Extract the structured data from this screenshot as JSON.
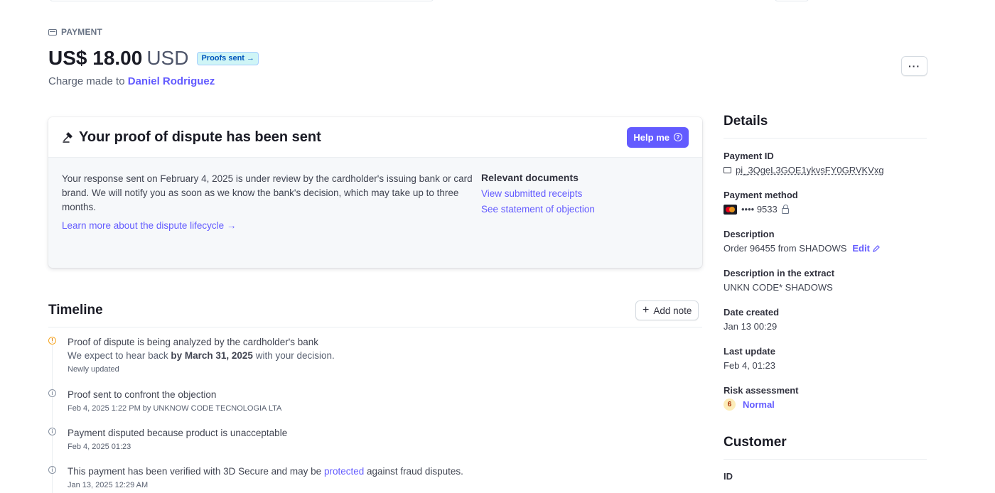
{
  "header": {
    "eyebrow": "PAYMENT",
    "amount": "US$ 18.00",
    "currency": "USD",
    "status_badge": "Proofs sent →",
    "charge_prefix": "Charge made to",
    "customer_name": "Daniel Rodriguez",
    "more_label": "···"
  },
  "dispute_card": {
    "title": "Your proof of dispute has been sent",
    "help_label": "Help me",
    "body": "Your response sent on February 4, 2025 is under review by the cardholder's issuing bank or card brand. We will notify you as soon as we know the bank's decision, which may take up to three months.",
    "learn_more": "Learn more about the dispute lifecycle →",
    "docs_title": "Relevant documents",
    "docs": [
      "View submitted receipts",
      "See statement of objection"
    ]
  },
  "timeline": {
    "title": "Timeline",
    "add_note_label": "Add note",
    "events": [
      {
        "icon": "warning-icon",
        "text": "Proof of dispute is being analyzed by the cardholder's bank",
        "sub_prefix": "We expect to hear back",
        "sub_bold": "by March 31, 2025",
        "sub_suffix": "with your decision.",
        "meta": "Newly updated"
      },
      {
        "icon": "info-icon",
        "text": "Proof sent to confront the objection",
        "meta": "Feb 4, 2025 1:22 PM by UNKNOW CODE TECNOLOGIA LTA"
      },
      {
        "icon": "info-icon",
        "text": "Payment disputed because product is unacceptable",
        "meta": "Feb 4, 2025 01:23"
      },
      {
        "icon": "info-icon",
        "text_prefix": "This payment has been verified with 3D Secure and may be",
        "text_link": "protected",
        "text_suffix": "against fraud disputes.",
        "meta": "Jan 13, 2025 12:29 AM"
      }
    ]
  },
  "details": {
    "title": "Details",
    "payment_id_label": "Payment ID",
    "payment_id": "pi_3QgeL3GOE1ykvsFY0GRVKVxg",
    "payment_method_label": "Payment method",
    "payment_method": "•••• 9533",
    "description_label": "Description",
    "description": "Order 96455 from SHADOWS",
    "edit_label": "Edit",
    "extract_label": "Description in the extract",
    "extract": "UNKN CODE* SHADOWS",
    "created_label": "Date created",
    "created": "Jan 13 00:29",
    "updated_label": "Last update",
    "updated": "Feb 4, 01:23",
    "risk_label": "Risk assessment",
    "risk_score": "6",
    "risk_level": "Normal"
  },
  "customer": {
    "title": "Customer",
    "id_label": "ID"
  },
  "colors": {
    "accent": "#635bff",
    "badge_bg": "#cff5f6",
    "badge_text": "#0055bc",
    "warning": "#f5a623"
  }
}
